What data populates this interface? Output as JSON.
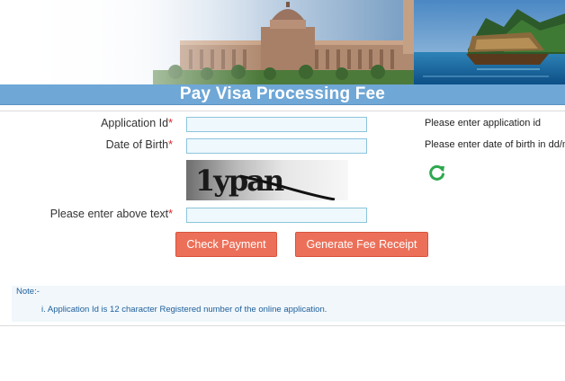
{
  "header": {
    "title": "Pay Visa Processing Fee"
  },
  "form": {
    "application_id": {
      "label": "Application Id",
      "required_mark": "*",
      "value": "",
      "hint": "Please enter application id"
    },
    "date_of_birth": {
      "label": "Date of Birth",
      "required_mark": "*",
      "value": "",
      "hint": "Please enter date of birth in dd/m"
    },
    "captcha": {
      "image_text": "1ypan",
      "refresh_icon": "refresh-icon"
    },
    "captcha_text": {
      "label": "Please enter above text",
      "required_mark": "*",
      "value": ""
    }
  },
  "buttons": {
    "check_payment": "Check Payment",
    "generate_receipt": "Generate Fee Receipt"
  },
  "note": {
    "heading": "Note:-",
    "items": [
      "i. Application Id is 12 character Registered number of the online application."
    ]
  },
  "colors": {
    "title_bar": "#6fa7d6",
    "button": "#ec7059",
    "field_border": "#8cc4dc",
    "field_bg": "#eef8fd",
    "required": "#d9272e",
    "note_text": "#1f5f9a",
    "refresh_icon": "#2fa84f"
  }
}
